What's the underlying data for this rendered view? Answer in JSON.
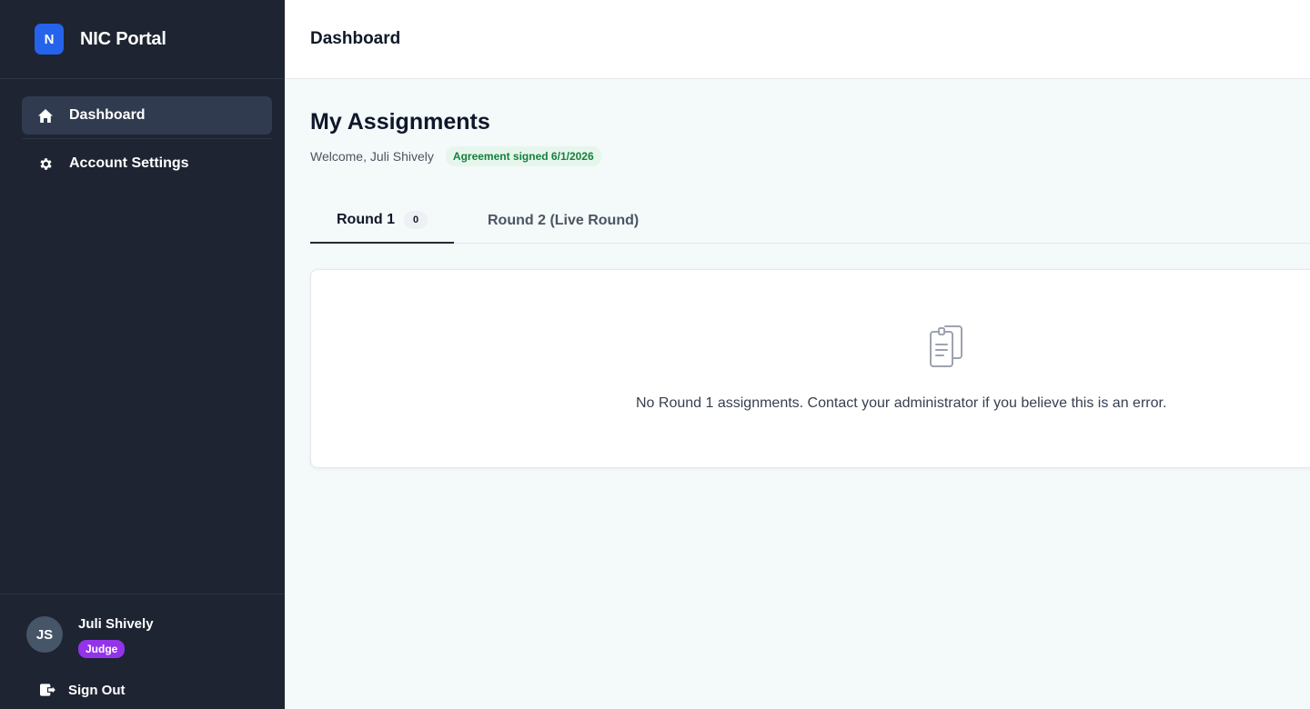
{
  "brand": {
    "logo_letter": "N",
    "title": "NIC Portal"
  },
  "sidebar": {
    "items": [
      {
        "label": "Dashboard",
        "icon": "home-icon",
        "active": true
      },
      {
        "label": "Account Settings",
        "icon": "gear-icon",
        "active": false
      }
    ]
  },
  "user": {
    "initials": "JS",
    "name": "Juli Shively",
    "role": "Judge",
    "sign_out_label": "Sign Out"
  },
  "header": {
    "title": "Dashboard"
  },
  "main": {
    "title": "My Assignments",
    "welcome": "Welcome, Juli Shively",
    "agreement_badge": "Agreement signed 6/1/2026",
    "tabs": [
      {
        "label": "Round 1",
        "count": "0",
        "active": true
      },
      {
        "label": "Round 2 (Live Round)",
        "active": false
      }
    ],
    "empty_state": {
      "icon": "clipboard-icon",
      "message": "No Round 1 assignments. Contact your administrator if you believe this is an error."
    }
  },
  "colors": {
    "sidebar_bg": "#1e2432",
    "brand_blue": "#2563eb",
    "role_purple": "#9333ea",
    "success_green": "#15803d"
  }
}
